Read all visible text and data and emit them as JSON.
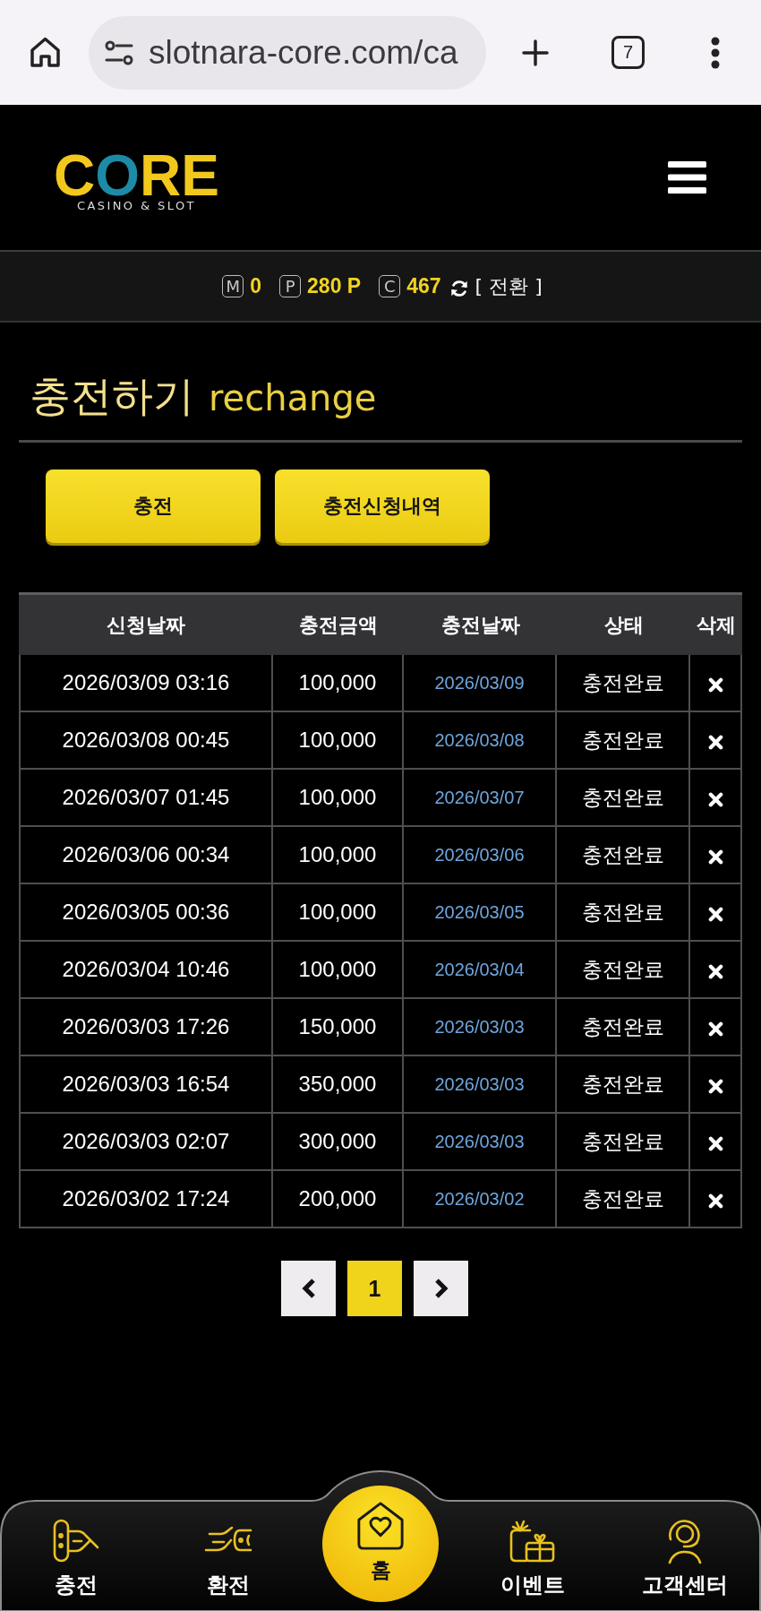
{
  "browser": {
    "url": "slotnara-core.com/ca",
    "tab_count": "7"
  },
  "header": {
    "logo": {
      "wordmark": "CORE",
      "tagline": "CASINO & SLOT"
    }
  },
  "balance_bar": {
    "items": [
      {
        "mark": "M",
        "value": "0"
      },
      {
        "mark": "P",
        "value": "280 P"
      },
      {
        "mark": "C",
        "value": "467"
      }
    ],
    "switch_label": "[ 전환 ]"
  },
  "page": {
    "title": "충전하기",
    "subtitle": "rechange"
  },
  "action_buttons": [
    {
      "label": "충전"
    },
    {
      "label": "충전신청내역"
    }
  ],
  "table": {
    "columns": [
      "신청날짜",
      "충전금액",
      "충전날짜",
      "상태",
      "삭제"
    ],
    "rows": [
      {
        "requested": "2026/03/09 03:16",
        "amount": "100,000",
        "charged_date": "2026/03/09",
        "status": "충전완료"
      },
      {
        "requested": "2026/03/08 00:45",
        "amount": "100,000",
        "charged_date": "2026/03/08",
        "status": "충전완료"
      },
      {
        "requested": "2026/03/07 01:45",
        "amount": "100,000",
        "charged_date": "2026/03/07",
        "status": "충전완료"
      },
      {
        "requested": "2026/03/06 00:34",
        "amount": "100,000",
        "charged_date": "2026/03/06",
        "status": "충전완료"
      },
      {
        "requested": "2026/03/05 00:36",
        "amount": "100,000",
        "charged_date": "2026/03/05",
        "status": "충전완료"
      },
      {
        "requested": "2026/03/04 10:46",
        "amount": "100,000",
        "charged_date": "2026/03/04",
        "status": "충전완료"
      },
      {
        "requested": "2026/03/03 17:26",
        "amount": "150,000",
        "charged_date": "2026/03/03",
        "status": "충전완료"
      },
      {
        "requested": "2026/03/03 16:54",
        "amount": "350,000",
        "charged_date": "2026/03/03",
        "status": "충전완료"
      },
      {
        "requested": "2026/03/03 02:07",
        "amount": "300,000",
        "charged_date": "2026/03/03",
        "status": "충전완료"
      },
      {
        "requested": "2026/03/02 17:24",
        "amount": "200,000",
        "charged_date": "2026/03/02",
        "status": "충전완료"
      }
    ]
  },
  "pagination": {
    "pages": [
      {
        "label": "1",
        "selected": true
      }
    ]
  },
  "bottom_nav": [
    {
      "label": "충전",
      "kind": "tab"
    },
    {
      "label": "환전",
      "kind": "tab"
    },
    {
      "label": "홈",
      "kind": "home"
    },
    {
      "label": "이벤트",
      "kind": "tab"
    },
    {
      "label": "고객센터",
      "kind": "tab"
    }
  ]
}
